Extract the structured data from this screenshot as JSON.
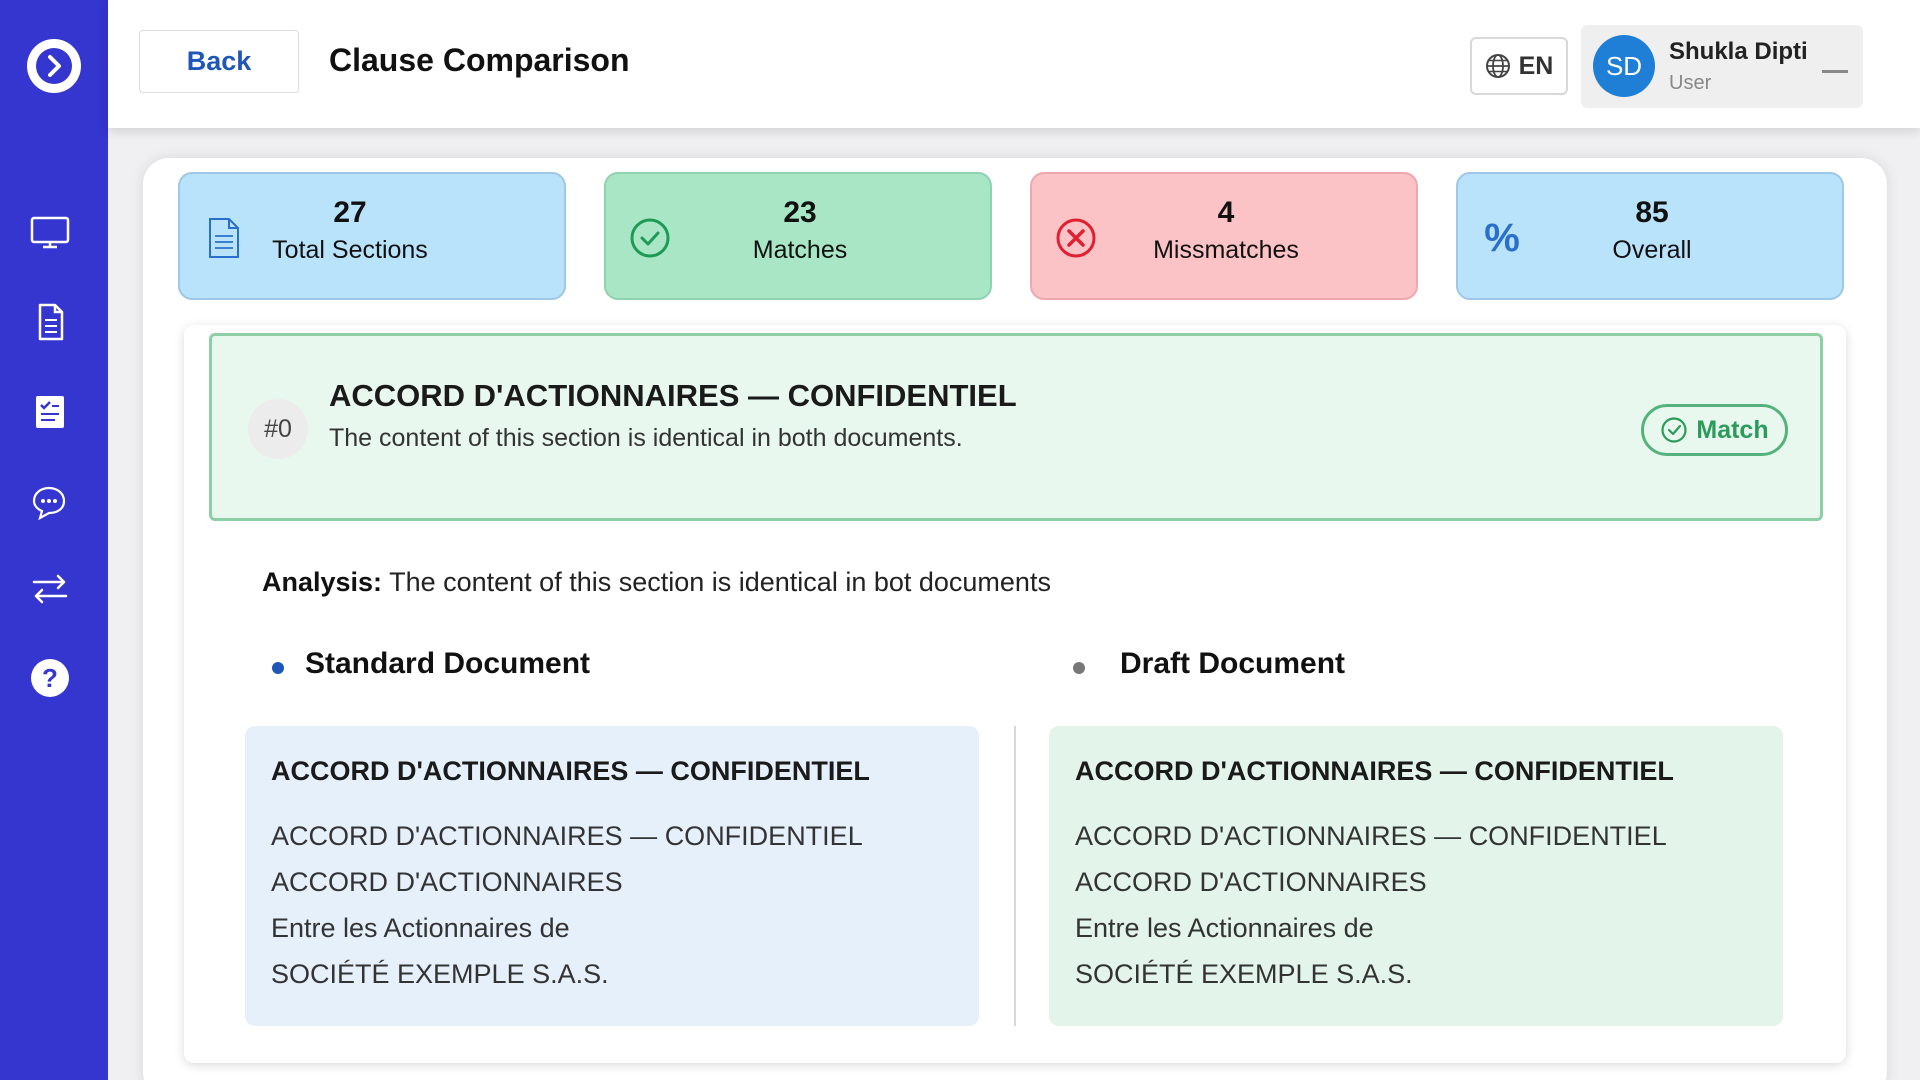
{
  "header": {
    "back_label": "Back",
    "title": "Clause Comparison",
    "language": "EN",
    "user": {
      "initials": "SD",
      "name": "Shukla Dipti",
      "role": "User"
    }
  },
  "sidebar": {
    "items": [
      {
        "name": "monitor-icon"
      },
      {
        "name": "document-icon"
      },
      {
        "name": "checklist-icon"
      },
      {
        "name": "chat-icon"
      },
      {
        "name": "compare-icon"
      },
      {
        "name": "help-icon"
      }
    ]
  },
  "stats": {
    "total": {
      "value": "27",
      "label": "Total Sections"
    },
    "matches": {
      "value": "23",
      "label": "Matches"
    },
    "mismatches": {
      "value": "4",
      "label": "Missmatches"
    },
    "overall": {
      "value": "85",
      "label": "Overall",
      "symbol": "%"
    }
  },
  "section": {
    "number": "#0",
    "title": "ACCORD D'ACTIONNAIRES — CONFIDENTIEL",
    "description": "The content of this section is identical in both documents.",
    "status": "Match"
  },
  "analysis": {
    "label": "Analysis:",
    "text": " The content of this section is identical in bot documents"
  },
  "standard_doc": {
    "heading": "Standard Document",
    "title": "ACCORD D'ACTIONNAIRES — CONFIDENTIEL",
    "lines": [
      "ACCORD D'ACTIONNAIRES — CONFIDENTIEL",
      "ACCORD D'ACTIONNAIRES",
      "Entre les Actionnaires de",
      "SOCIÉTÉ EXEMPLE S.A.S."
    ]
  },
  "draft_doc": {
    "heading": "Draft Document",
    "title": "ACCORD D'ACTIONNAIRES — CONFIDENTIEL",
    "lines": [
      "ACCORD D'ACTIONNAIRES — CONFIDENTIEL",
      "ACCORD D'ACTIONNAIRES",
      "Entre les Actionnaires de",
      "SOCIÉTÉ EXEMPLE S.A.S."
    ]
  },
  "colors": {
    "sidebar": "#3535cf",
    "accent_blue": "#1f57b8",
    "match_green": "#2b9a5a",
    "mismatch_red": "#e02030"
  }
}
